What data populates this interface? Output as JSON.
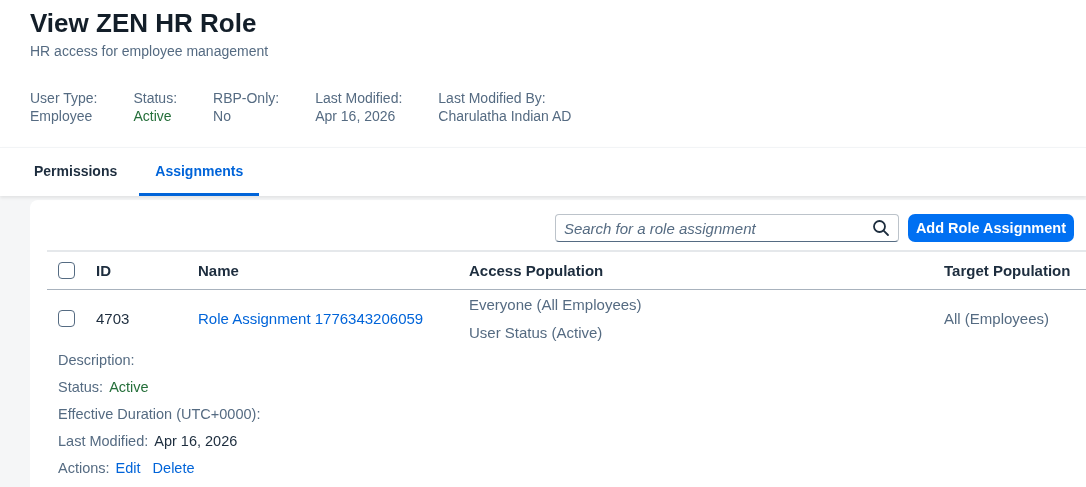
{
  "title": "View ZEN HR Role",
  "subtitle": "HR access for employee management",
  "attributes": [
    {
      "label": "User Type:",
      "value": "Employee",
      "kind": "text"
    },
    {
      "label": "Status:",
      "value": "Active",
      "kind": "status"
    },
    {
      "label": "RBP-Only:",
      "value": "No",
      "kind": "text"
    },
    {
      "label": "Last Modified:",
      "value": "Apr 16, 2026",
      "kind": "text"
    },
    {
      "label": "Last Modified By:",
      "value": "Charulatha Indian AD",
      "kind": "text"
    }
  ],
  "tabs": [
    {
      "label": "Permissions",
      "selected": false
    },
    {
      "label": "Assignments",
      "selected": true
    }
  ],
  "search": {
    "placeholder": "Search for a role assignment"
  },
  "add_button": "Add Role Assignment",
  "table": {
    "columns": [
      "ID",
      "Name",
      "Access Population",
      "Target Population"
    ],
    "header_checked": false,
    "rows": [
      {
        "checked": false,
        "id": "4703",
        "name": "Role Assignment 1776343206059",
        "access_population": [
          "Everyone (All Employees)",
          "User Status (Active)"
        ],
        "target_population": "All (Employees)",
        "details": [
          {
            "kind": "text",
            "label": "Description:"
          },
          {
            "kind": "status",
            "label": "Status:",
            "value": "Active"
          },
          {
            "kind": "text",
            "label": "Effective Duration (UTC+0000):"
          },
          {
            "kind": "text",
            "label": "Last Modified:",
            "value": "Apr 16, 2026"
          },
          {
            "kind": "links",
            "label": "Actions:",
            "links": [
              "Edit",
              "Delete"
            ]
          }
        ]
      }
    ]
  }
}
